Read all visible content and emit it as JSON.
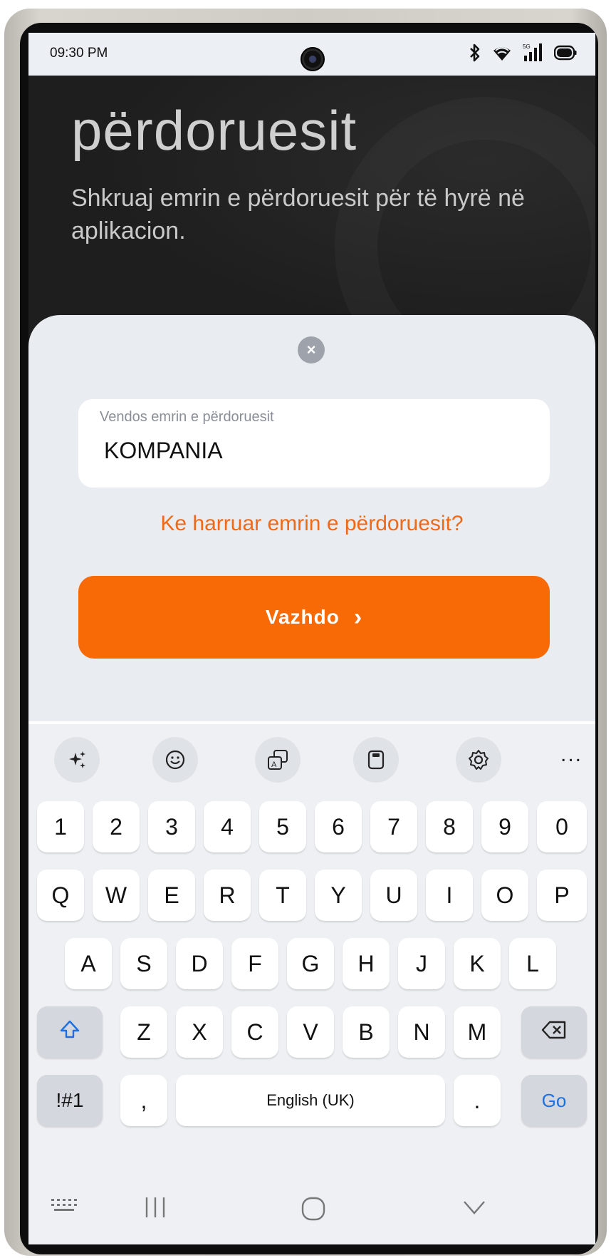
{
  "status_bar": {
    "time": "09:30 PM",
    "icons": [
      "bluetooth-icon",
      "wifi-icon",
      "signal-5g-icon",
      "battery-icon"
    ]
  },
  "header": {
    "title": "përdoruesit",
    "subtitle": "Shkruaj emrin e përdoruesit për të hyrë në aplikacion."
  },
  "form": {
    "field_label": "Vendos emrin e përdoruesit",
    "field_value": "KOMPANIA",
    "forgot_link": "Ke harruar emrin e përdoruesit?",
    "continue_label": "Vazhdo",
    "continue_icon": "›"
  },
  "keyboard": {
    "toolbar": [
      "sparkle-icon",
      "emoji-icon",
      "translate-icon",
      "clipboard-icon",
      "settings-icon"
    ],
    "more": "...",
    "row_numbers": [
      "1",
      "2",
      "3",
      "4",
      "5",
      "6",
      "7",
      "8",
      "9",
      "0"
    ],
    "row_q": [
      "Q",
      "W",
      "E",
      "R",
      "T",
      "Y",
      "U",
      "I",
      "O",
      "P"
    ],
    "row_a": [
      "A",
      "S",
      "D",
      "F",
      "G",
      "H",
      "J",
      "K",
      "L"
    ],
    "row_z": [
      "Z",
      "X",
      "C",
      "V",
      "B",
      "N",
      "M"
    ],
    "symbols_key": "!#1",
    "comma_key": ",",
    "space_key": "English (UK)",
    "period_key": ".",
    "go_key": "Go"
  },
  "colors": {
    "accent": "#f76a06",
    "link": "#ee6a1a",
    "go": "#1e6fe0"
  }
}
